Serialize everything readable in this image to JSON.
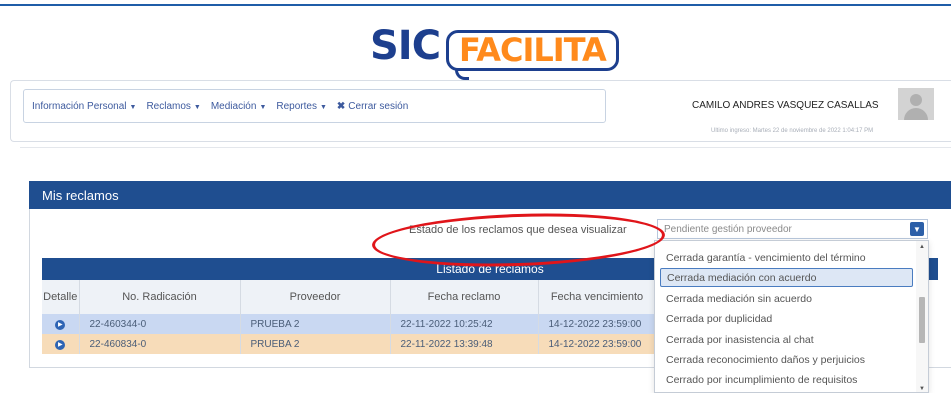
{
  "logo": {
    "sic": "SIC",
    "facilita": "FACILITA"
  },
  "nav": {
    "items": [
      {
        "label": "Información Personal"
      },
      {
        "label": "Reclamos"
      },
      {
        "label": "Mediación"
      },
      {
        "label": "Reportes"
      }
    ],
    "logout": "Cerrar sesión"
  },
  "user": {
    "name": "CAMILO ANDRES VASQUEZ CASALLAS",
    "last_login": "Ultimo ingreso: Martes 22 de noviembre de 2022 1:04:17 PM"
  },
  "panel": {
    "title": "Mis reclamos",
    "filter_label": "Estado de los reclamos que desea visualizar",
    "filter_value": "Pendiente gestión proveedor"
  },
  "table": {
    "title": "Listado de reclamos",
    "headers": [
      "Detalle",
      "No. Radicación",
      "Proveedor",
      "Fecha reclamo",
      "Fecha vencimiento"
    ],
    "rows": [
      {
        "radicacion": "22-460344-0",
        "proveedor": "PRUEBA 2",
        "fecha_reclamo": "22-11-2022 10:25:42",
        "fecha_vencimiento": "14-12-2022 23:59:00"
      },
      {
        "radicacion": "22-460834-0",
        "proveedor": "PRUEBA 2",
        "fecha_reclamo": "22-11-2022 13:39:48",
        "fecha_vencimiento": "14-12-2022 23:59:00"
      }
    ]
  },
  "dropdown": {
    "options": [
      "Cerrada garantía - vencimiento del término",
      "Cerrada mediación con acuerdo",
      "Cerrada mediación sin acuerdo",
      "Cerrada por duplicidad",
      "Cerrada por inasistencia al chat",
      "Cerrada reconocimiento daños y perjuicios",
      "Cerrado por incumplimiento de requisitos"
    ],
    "highlighted": "Cerrada mediación con acuerdo"
  },
  "colors": {
    "brand_blue": "#1f4e90",
    "brand_orange": "#ff8a1c",
    "row_blue": "#c9d8f2",
    "row_orange": "#f7dcb9",
    "annotation_red": "#e0151a"
  }
}
